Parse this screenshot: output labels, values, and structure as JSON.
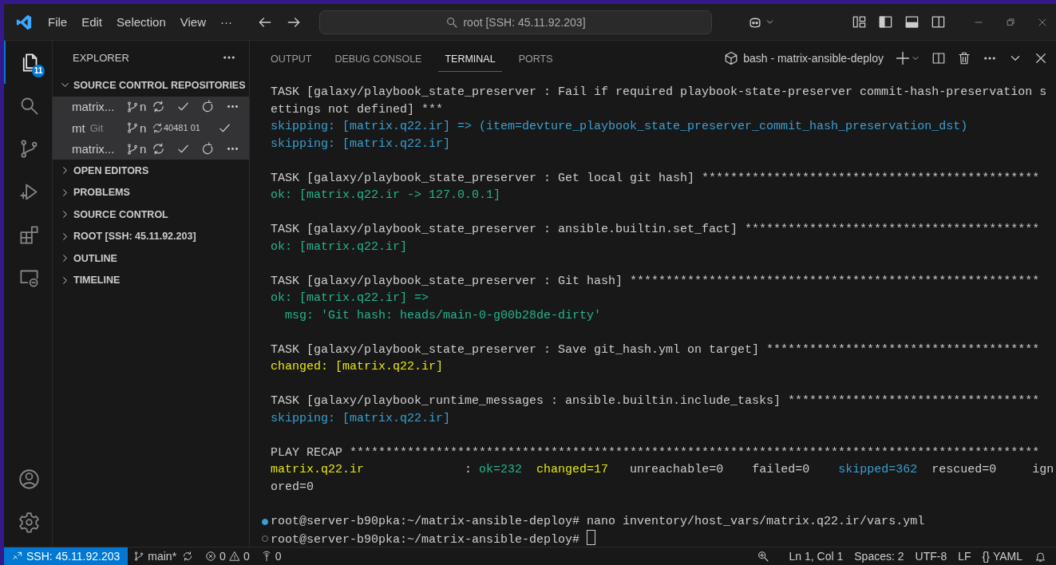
{
  "title_bar": {
    "menu": [
      "File",
      "Edit",
      "Selection",
      "View",
      "···"
    ],
    "search": "root [SSH: 45.11.92.203]"
  },
  "activity_bar": {
    "items": [
      {
        "kind": "explorer",
        "selected": true,
        "badge": "11"
      },
      {
        "kind": "search",
        "selected": false
      },
      {
        "kind": "source-control",
        "selected": false
      },
      {
        "kind": "run-debug",
        "selected": false
      },
      {
        "kind": "extensions",
        "selected": false
      },
      {
        "kind": "remote-explorer",
        "selected": false
      }
    ],
    "bottom": [
      {
        "kind": "account"
      },
      {
        "kind": "settings"
      }
    ]
  },
  "sidebar": {
    "title": "EXPLORER",
    "sections": [
      {
        "label": "SOURCE CONTROL REPOSITORIES",
        "expanded": true,
        "repositories": [
          {
            "name": "matrix...",
            "branch": "n",
            "actions": [
              {
                "kind": "sync"
              },
              {
                "kind": "commit"
              },
              {
                "kind": "refresh"
              },
              {
                "kind": "more"
              }
            ]
          },
          {
            "name": "mt",
            "provider": "Git",
            "branch": "n",
            "sync_count": "40481 01",
            "actions": [
              {
                "kind": "commit"
              }
            ]
          },
          {
            "name": "matrix...",
            "branch": "n",
            "actions": [
              {
                "kind": "sync"
              },
              {
                "kind": "commit"
              },
              {
                "kind": "refresh"
              },
              {
                "kind": "more"
              }
            ]
          }
        ]
      },
      {
        "label": "OPEN EDITORS",
        "expanded": false
      },
      {
        "label": "PROBLEMS",
        "expanded": false
      },
      {
        "label": "SOURCE CONTROL",
        "expanded": false
      },
      {
        "label": "ROOT [SSH: 45.11.92.203]",
        "expanded": false
      },
      {
        "label": "OUTLINE",
        "expanded": false
      },
      {
        "label": "TIMELINE",
        "expanded": false
      }
    ]
  },
  "panel": {
    "tabs": [
      {
        "label": "OUTPUT",
        "selected": false
      },
      {
        "label": "DEBUG CONSOLE",
        "selected": false
      },
      {
        "label": "TERMINAL",
        "selected": true
      },
      {
        "label": "PORTS",
        "selected": false
      }
    ],
    "terminal_name": "bash - matrix-ansible-deploy",
    "terminal": {
      "blocks": [
        {
          "lines": [
            {
              "segments": [
                {
                  "kind": "plain",
                  "text": "TASK [galaxy/playbook_state_preserver : Fail if required playbook-state-preserver commit-hash-preservation s"
                }
              ]
            },
            {
              "segments": [
                {
                  "kind": "plain",
                  "text": "ettings not defined] ***"
                }
              ]
            },
            {
              "segments": [
                {
                  "kind": "skipped",
                  "text": "skipping: [matrix.q22.ir] => (item=devture_playbook_state_preserver_commit_hash_preservation_dst)"
                }
              ]
            },
            {
              "segments": [
                {
                  "kind": "skipped",
                  "text": "skipping: [matrix.q22.ir]"
                }
              ]
            }
          ]
        },
        {
          "lines": [
            {
              "segments": [
                {
                  "kind": "plain",
                  "text": "TASK [galaxy/playbook_state_preserver : Get local git hash] ***********************************************"
                }
              ]
            },
            {
              "segments": [
                {
                  "kind": "ok",
                  "text": "ok: [matrix.q22.ir -> 127.0.0.1]"
                }
              ]
            }
          ]
        },
        {
          "lines": [
            {
              "segments": [
                {
                  "kind": "plain",
                  "text": "TASK [galaxy/playbook_state_preserver : ansible.builtin.set_fact] *****************************************"
                }
              ]
            },
            {
              "segments": [
                {
                  "kind": "ok",
                  "text": "ok: [matrix.q22.ir]"
                }
              ]
            }
          ]
        },
        {
          "lines": [
            {
              "segments": [
                {
                  "kind": "plain",
                  "text": "TASK [galaxy/playbook_state_preserver : Git hash] *********************************************************"
                }
              ]
            },
            {
              "segments": [
                {
                  "kind": "ok",
                  "text": "ok: [matrix.q22.ir] =>"
                }
              ]
            },
            {
              "segments": [
                {
                  "kind": "ok",
                  "text": "  msg: 'Git hash: heads/main-0-g00b28de-dirty'"
                }
              ]
            }
          ]
        },
        {
          "lines": [
            {
              "segments": [
                {
                  "kind": "plain",
                  "text": "TASK [galaxy/playbook_state_preserver : Save git_hash.yml on target] **************************************"
                }
              ]
            },
            {
              "segments": [
                {
                  "kind": "changed",
                  "text": "changed: [matrix.q22.ir]"
                }
              ]
            }
          ]
        },
        {
          "lines": [
            {
              "segments": [
                {
                  "kind": "plain",
                  "text": "TASK [galaxy/playbook_runtime_messages : ansible.builtin.include_tasks] ***********************************"
                }
              ]
            },
            {
              "segments": [
                {
                  "kind": "skipped",
                  "text": "skipping: [matrix.q22.ir]"
                }
              ]
            }
          ]
        },
        {
          "lines": [
            {
              "segments": [
                {
                  "kind": "plain",
                  "text": "PLAY RECAP ************************************************************************************************"
                }
              ]
            },
            {
              "segments": [
                {
                  "kind": "changed",
                  "text": "matrix.q22.ir"
                },
                {
                  "kind": "plain",
                  "text": "              : "
                },
                {
                  "kind": "ok",
                  "text": "ok=232"
                },
                {
                  "kind": "changed",
                  "text": "  changed=17"
                },
                {
                  "kind": "plain",
                  "text": "   unreachable=0    failed=0    "
                },
                {
                  "kind": "skipped",
                  "text": "skipped=362"
                },
                {
                  "kind": "plain",
                  "text": "  rescued=0     ign"
                }
              ]
            },
            {
              "segments": [
                {
                  "kind": "plain",
                  "text": "ored=0"
                }
              ]
            }
          ]
        }
      ],
      "prompts": [
        {
          "succeeded": true,
          "text": "root@server-b90pka:~/matrix-ansible-deploy# nano inventory/host_vars/matrix.q22.ir/vars.yml",
          "cursor": false
        },
        {
          "succeeded": false,
          "text": "root@server-b90pka:~/matrix-ansible-deploy# ",
          "cursor": true
        }
      ]
    }
  },
  "status_bar": {
    "remote": "SSH: 45.11.92.203",
    "branch": "main*",
    "errors": "0",
    "warnings": "0",
    "ports": "0",
    "position": "Ln 1, Col 1",
    "indentation": "Spaces: 2",
    "encoding": "UTF-8",
    "eol": "LF",
    "language_icon": "{}",
    "language": "YAML"
  }
}
